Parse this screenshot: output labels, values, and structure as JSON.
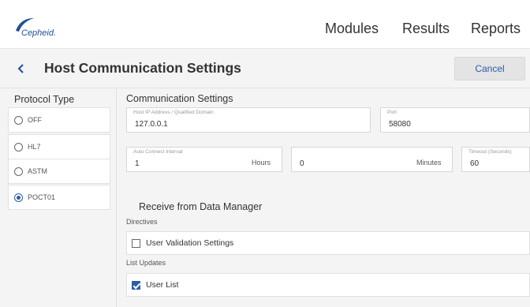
{
  "header": {
    "logo_text": "Cepheid.",
    "nav": [
      "Modules",
      "Results",
      "Reports"
    ]
  },
  "title_bar": {
    "back_icon": "chevron-left-icon",
    "title": "Host Communication Settings",
    "cancel_label": "Cancel"
  },
  "protocol": {
    "heading": "Protocol Type",
    "options": [
      {
        "label": "OFF",
        "selected": false
      },
      {
        "label": "HL7",
        "selected": false
      },
      {
        "label": "ASTM",
        "selected": false
      },
      {
        "label": "POCT01",
        "selected": true
      }
    ]
  },
  "communication": {
    "heading": "Communication Settings",
    "host": {
      "label": "Host IP Address / Qualified Domain",
      "value": "127.0.0.1"
    },
    "port": {
      "label": "Port",
      "value": "58080"
    },
    "auto_connect": {
      "label": "Auto Connect Interval",
      "hours_value": "1",
      "hours_unit": "Hours",
      "minutes_value": "0",
      "minutes_unit": "Minutes"
    },
    "timeout": {
      "label": "Timeout (Seconds)",
      "value": "60"
    }
  },
  "receive": {
    "heading": "Receive from Data Manager",
    "directives_label": "Directives",
    "user_validation": {
      "label": "User Validation Settings",
      "checked": false
    },
    "list_updates_label": "List Updates",
    "user_list": {
      "label": "User List",
      "checked": true
    }
  },
  "colors": {
    "accent": "#2a5da8",
    "logo": "#1e4f9a",
    "panel_bg": "#f4f4f4"
  }
}
